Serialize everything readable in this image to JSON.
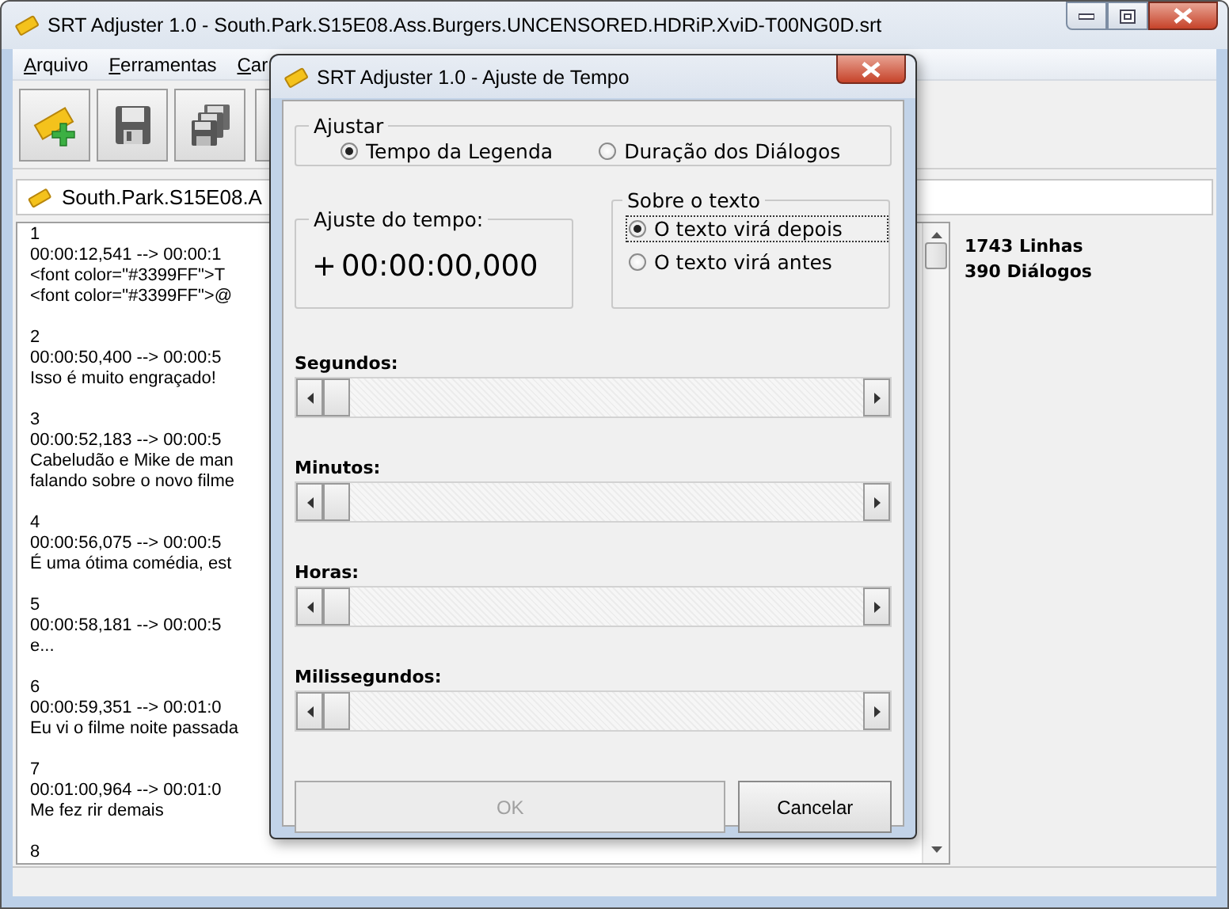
{
  "window": {
    "title": "SRT Adjuster 1.0 - South.Park.S15E08.Ass.Burgers.UNCENSORED.HDRiP.XviD-T00NG0D.srt"
  },
  "menu": [
    {
      "label": "Arquivo"
    },
    {
      "label": "Ferramentas"
    },
    {
      "label": "Car"
    }
  ],
  "file_tab": {
    "label": "South.Park.S15E08.A"
  },
  "subtitle_blocks": [
    {
      "number": "1",
      "lines": [
        "00:00:12,541 --> 00:00:1",
        "<font color=\"#3399FF\">T",
        "<font color=\"#3399FF\">@"
      ]
    },
    {
      "number": "2",
      "lines": [
        "00:00:50,400 --> 00:00:5",
        "Isso é muito engraçado!"
      ]
    },
    {
      "number": "3",
      "lines": [
        "00:00:52,183 --> 00:00:5",
        "Cabeludão e Mike de man",
        "falando sobre o novo filme"
      ]
    },
    {
      "number": "4",
      "lines": [
        "00:00:56,075 --> 00:00:5",
        "É uma ótima comédia, est"
      ]
    },
    {
      "number": "5",
      "lines": [
        "00:00:58,181 --> 00:00:5",
        "e..."
      ]
    },
    {
      "number": "6",
      "lines": [
        "00:00:59,351 --> 00:01:0",
        "Eu vi o filme noite passada"
      ]
    },
    {
      "number": "7",
      "lines": [
        "00:01:00,964 --> 00:01:0",
        "Me fez rir demais"
      ]
    },
    {
      "number": "8"
    }
  ],
  "stats": [
    "1743 Linhas",
    "390 Diálogos"
  ],
  "dialog": {
    "title": "SRT Adjuster 1.0 - Ajuste de Tempo",
    "adjust_group": {
      "title": "Ajustar",
      "options": [
        {
          "label": "Tempo da Legenda",
          "selected": true
        },
        {
          "label": "Duração dos Diálogos",
          "selected": false
        }
      ]
    },
    "offset_group": {
      "title": "Ajuste do tempo:",
      "sign": "+",
      "value": "00:00:00,000"
    },
    "text_group": {
      "title": "Sobre o texto",
      "options": [
        {
          "label": "O texto virá depois",
          "selected": true,
          "focused": true
        },
        {
          "label": "O texto virá antes",
          "selected": false,
          "focused": false
        }
      ]
    },
    "sliders": [
      {
        "label": "Segundos:",
        "level": 0
      },
      {
        "label": "Minutos:",
        "level": 0
      },
      {
        "label": "Horas:",
        "level": 0
      },
      {
        "label": "Milissegundos:",
        "level": 0
      }
    ],
    "buttons": [
      {
        "label": "OK",
        "disabled": true
      },
      {
        "label": "Cancelar",
        "disabled": false
      }
    ]
  }
}
